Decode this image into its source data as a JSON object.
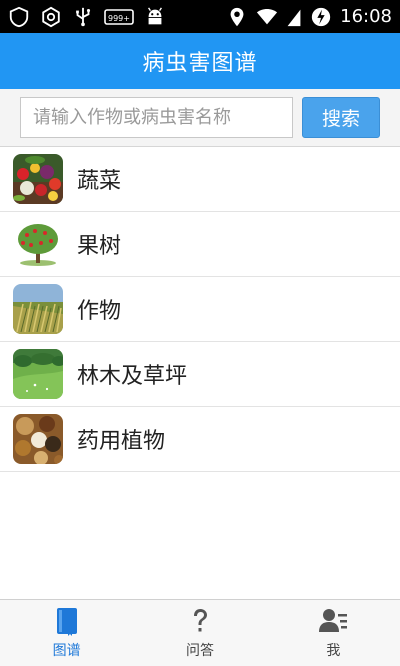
{
  "status_bar": {
    "time": "16:08",
    "left_icons": [
      "shield-alert-icon",
      "target-icon",
      "usb-icon",
      "notification-count-icon",
      "android-icon"
    ],
    "right_icons": [
      "location-icon",
      "wifi-icon",
      "signal-icon",
      "battery-charging-icon"
    ],
    "notification_count": "999+"
  },
  "header": {
    "title": "病虫害图谱",
    "color": "#2196f3"
  },
  "search": {
    "placeholder": "请输入作物或病虫害名称",
    "button_label": "搜索"
  },
  "categories": [
    {
      "label": "蔬菜",
      "icon": "vegetables-icon"
    },
    {
      "label": "果树",
      "icon": "fruit-tree-icon"
    },
    {
      "label": "作物",
      "icon": "crops-icon"
    },
    {
      "label": "林木及草坪",
      "icon": "forest-lawn-icon"
    },
    {
      "label": "药用植物",
      "icon": "medicinal-plants-icon"
    }
  ],
  "bottom_nav": {
    "tabs": [
      {
        "label": "图谱",
        "icon": "book-icon",
        "active": true
      },
      {
        "label": "问答",
        "icon": "question-icon",
        "active": false
      },
      {
        "label": "我",
        "icon": "user-icon",
        "active": false
      }
    ],
    "active_color": "#1e78d8"
  }
}
